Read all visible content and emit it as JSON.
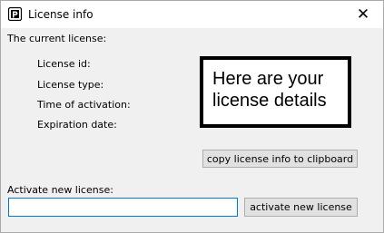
{
  "window": {
    "title": "License info",
    "close_glyph": "✕"
  },
  "current_license": {
    "heading": "The current license:",
    "fields": [
      {
        "label": "License id:"
      },
      {
        "label": "License type:"
      },
      {
        "label": "Time of activation:"
      },
      {
        "label": "Expiration date:"
      }
    ],
    "annotation_line1": "Here are your",
    "annotation_line2": "license details",
    "copy_button": "copy license info to clipboard"
  },
  "activate": {
    "label": "Activate new license:",
    "input_value": "",
    "input_placeholder": "",
    "button": "activate new license"
  },
  "colors": {
    "window_bg": "#f0f0f0",
    "titlebar_bg": "#ffffff",
    "button_bg": "#e1e1e1",
    "input_border_focus": "#0078d7"
  }
}
